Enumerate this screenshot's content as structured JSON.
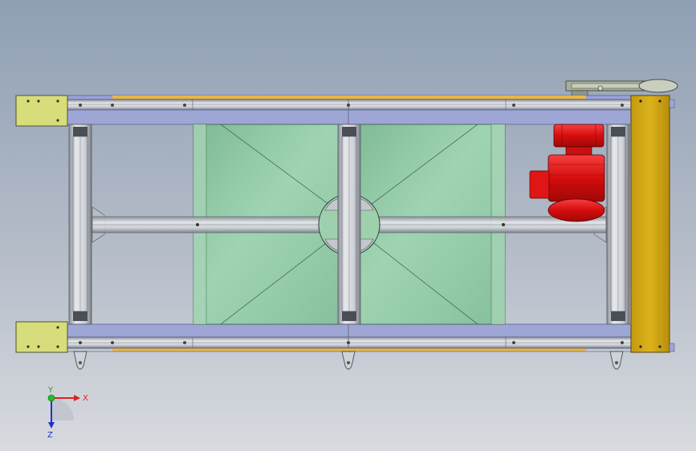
{
  "viewport": {
    "background_top": "#8f9fb4",
    "background_bottom": "#d8dadf"
  },
  "colors": {
    "rail_blue": "#9ea6d6",
    "rail_blue_dark": "#5a6298",
    "extrusion_gray": "#c9cdd4",
    "extrusion_dark": "#6c7078",
    "end_plate_yellow": "#d6dd7a",
    "side_plate_gold": "#d4a713",
    "belt_strip": "#e3b53a",
    "glass_green": "#8fc7a4",
    "motor_red": "#e01515",
    "gear_gray": "#b7bfae"
  },
  "triad": {
    "x_label": "X",
    "y_label": "Y",
    "z_label": "Z",
    "x_color": "#e02020",
    "y_color": "#20c020",
    "z_color": "#2030d0"
  },
  "components": [
    "end-plate-top-left",
    "end-plate-bottom-left",
    "side-plate-right",
    "top-rail",
    "bottom-rail",
    "glass-panel-left",
    "glass-panel-right",
    "gear-motor",
    "gear-reducer-top",
    "leveling-feet"
  ]
}
